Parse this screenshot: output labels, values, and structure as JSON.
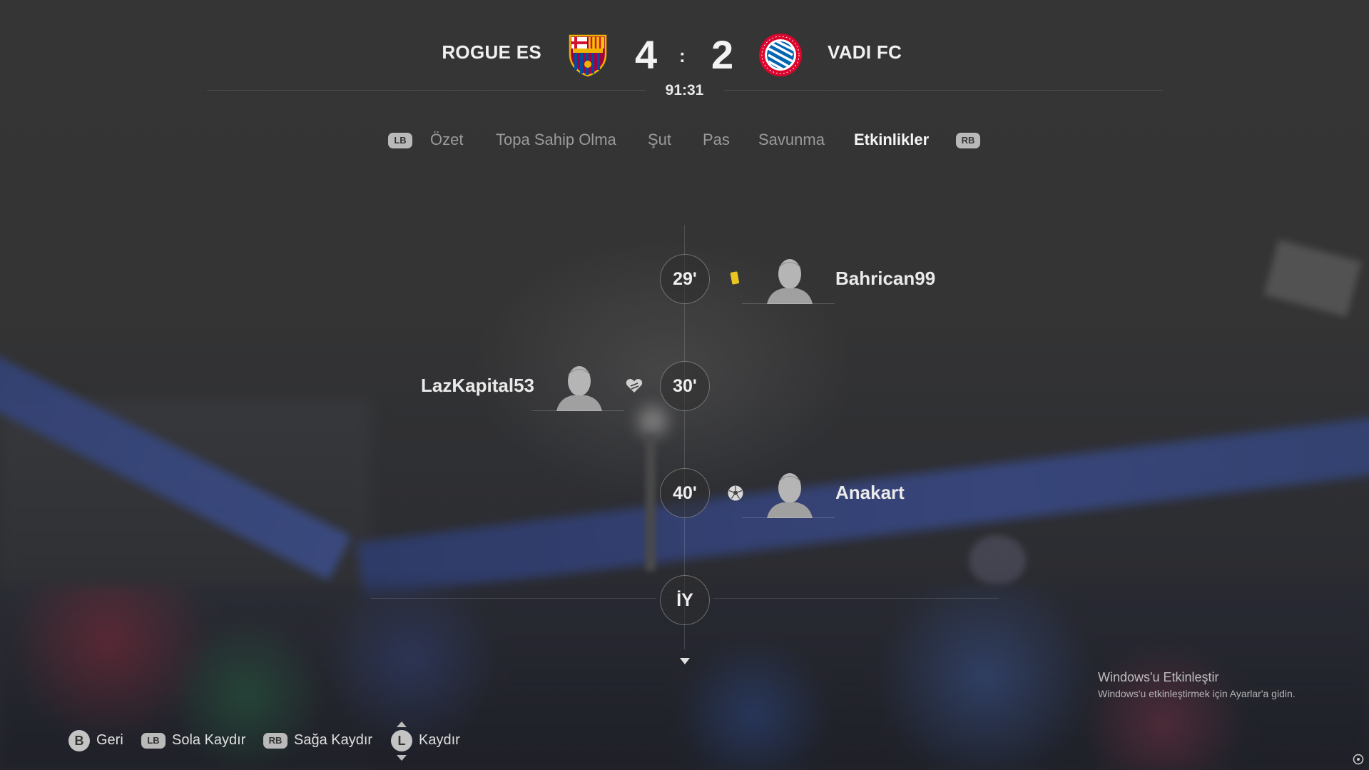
{
  "match": {
    "home": {
      "name": "ROGUE ES",
      "score": "4"
    },
    "away": {
      "name": "VADI FC",
      "score": "2"
    },
    "separator": ":",
    "clock": "91:31"
  },
  "tabs": {
    "left_bumper": "LB",
    "right_bumper": "RB",
    "items": [
      {
        "label": "Özet",
        "active": false
      },
      {
        "label": "Topa Sahip Olma",
        "active": false
      },
      {
        "label": "Şut",
        "active": false
      },
      {
        "label": "Pas",
        "active": false
      },
      {
        "label": "Savunma",
        "active": false
      },
      {
        "label": "Etkinlikler",
        "active": true
      }
    ]
  },
  "events": [
    {
      "minute": "29'",
      "side": "away",
      "type": "yellow-card",
      "player": "Bahrican99"
    },
    {
      "minute": "30'",
      "side": "home",
      "type": "injury",
      "player": "LazKapital53"
    },
    {
      "minute": "40'",
      "side": "away",
      "type": "goal",
      "player": "Anakart"
    },
    {
      "minute": "İY",
      "side": "center",
      "type": "half-time",
      "player": ""
    }
  ],
  "controls": [
    {
      "key": "B",
      "label": "Geri"
    },
    {
      "key": "LB",
      "label": "Sola Kaydır"
    },
    {
      "key": "RB",
      "label": "Sağa Kaydır"
    },
    {
      "key": "L",
      "label": "Kaydır"
    }
  ],
  "watermark": {
    "title": "Windows'u Etkinleştir",
    "subtitle": "Windows'u etkinleştirmek için Ayarlar'a gidin."
  },
  "colors": {
    "yellow_card": "#e8c520",
    "active_tab": "#f5f5f5",
    "inactive_tab": "#9a9a9a"
  }
}
